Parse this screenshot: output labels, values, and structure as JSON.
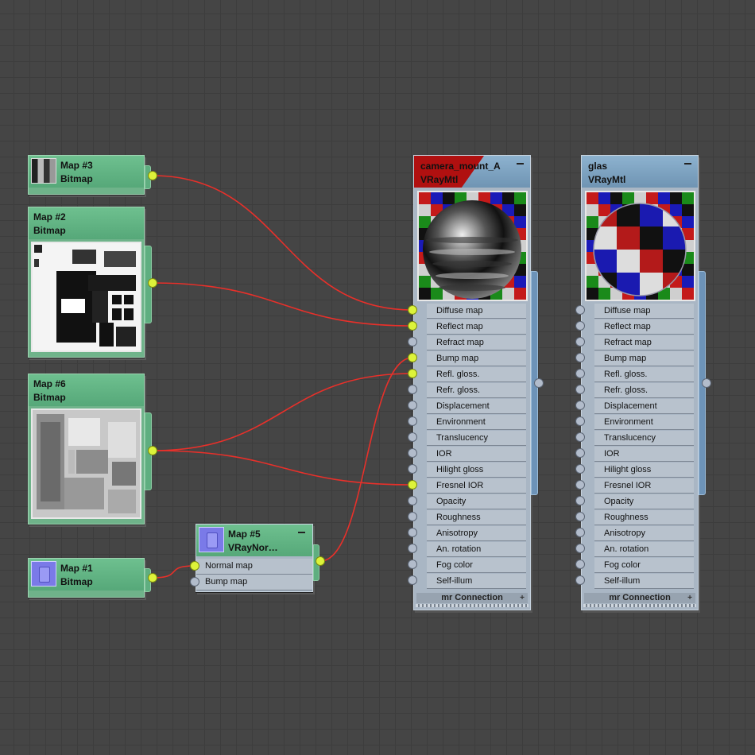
{
  "map_nodes": {
    "map3": {
      "name": "Map #3",
      "type": "Bitmap"
    },
    "map2": {
      "name": "Map #2",
      "type": "Bitmap"
    },
    "map6": {
      "name": "Map #6",
      "type": "Bitmap"
    },
    "map1": {
      "name": "Map #1",
      "type": "Bitmap"
    },
    "map5": {
      "name": "Map #5",
      "type": "VRayNor…",
      "slots": [
        "Normal map",
        "Bump map"
      ]
    }
  },
  "materials": [
    {
      "name": "camera_mount_A",
      "type": "VRayMtl",
      "preview": "chrome-sphere-on-checker"
    },
    {
      "name": "glas",
      "type": "VRayMtl",
      "preview": "glass-sphere-on-checker"
    }
  ],
  "material_slots": [
    "Diffuse map",
    "Reflect map",
    "Refract map",
    "Bump map",
    "Refl. gloss.",
    "Refr. gloss.",
    "Displacement",
    "Environment",
    "Translucency",
    "IOR",
    "Hilight gloss",
    "Fresnel IOR",
    "Opacity",
    "Roughness",
    "Anisotropy",
    "An. rotation",
    "Fog color",
    "Self-illum"
  ],
  "footer_label": "mr Connection",
  "footer_plus": "+",
  "connections": [
    {
      "from": "Map #3",
      "to": "camera_mount_A",
      "slot": "Diffuse map"
    },
    {
      "from": "Map #2",
      "to": "camera_mount_A",
      "slot": "Reflect map"
    },
    {
      "from": "Map #5",
      "to": "camera_mount_A",
      "slot": "Bump map"
    },
    {
      "from": "Map #6",
      "to": "camera_mount_A",
      "slot": "Refl. gloss."
    },
    {
      "from": "Map #6",
      "to": "camera_mount_A",
      "slot": "Fresnel IOR"
    },
    {
      "from": "Map #1",
      "to": "Map #5",
      "slot": "Normal map"
    }
  ],
  "colors": {
    "wire": "#e8302a",
    "socket_active": "#ddf33a",
    "socket_idle": "#b2bccb",
    "map_node": "#6fb38a",
    "material_node": "#a9b6c4",
    "material_header": "#7ea3c2",
    "error_flag": "#b01010"
  }
}
